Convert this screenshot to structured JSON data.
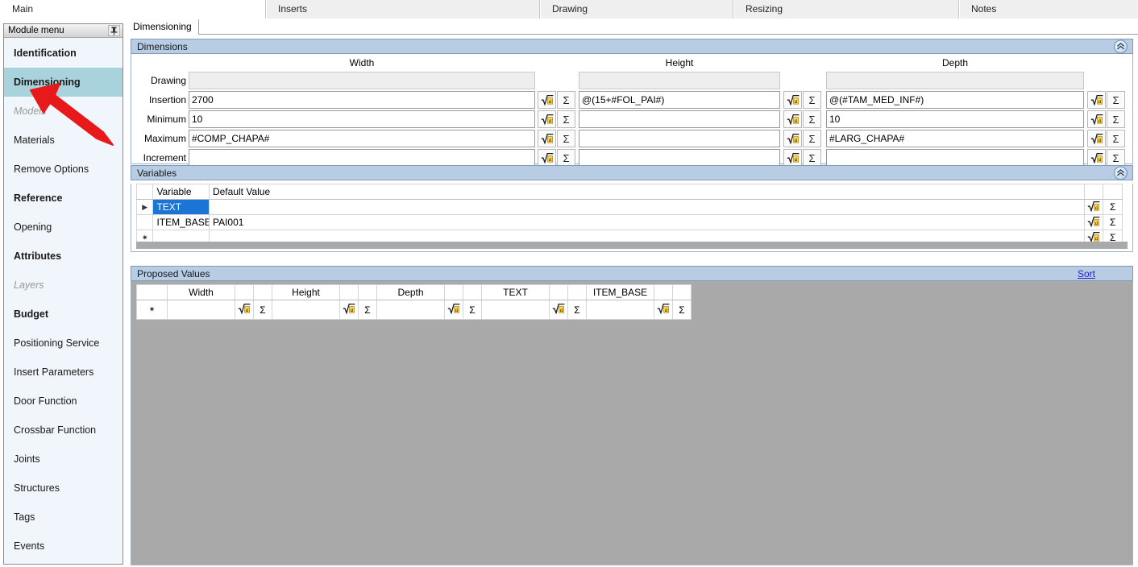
{
  "top_tabs": [
    {
      "label": "Main",
      "active": true
    },
    {
      "label": "Inserts",
      "active": false
    },
    {
      "label": "Drawing",
      "active": false
    },
    {
      "label": "Resizing",
      "active": false
    },
    {
      "label": "Notes",
      "active": false
    }
  ],
  "sub_tabs": [
    {
      "label": "Dimensioning",
      "active": true
    }
  ],
  "sidebar": {
    "title": "Module menu",
    "pin_icon": "pin-icon",
    "items": [
      {
        "label": "Identification",
        "style": "bold",
        "selected": false
      },
      {
        "label": "Dimensioning",
        "style": "bold",
        "selected": true
      },
      {
        "label": "Models",
        "style": "disabled",
        "selected": false
      },
      {
        "label": "Materials",
        "style": "normal",
        "selected": false
      },
      {
        "label": "Remove Options",
        "style": "normal",
        "selected": false
      },
      {
        "label": "Reference",
        "style": "bold",
        "selected": false
      },
      {
        "label": "Opening",
        "style": "normal",
        "selected": false
      },
      {
        "label": "Attributes",
        "style": "bold",
        "selected": false
      },
      {
        "label": "Layers",
        "style": "disabled",
        "selected": false
      },
      {
        "label": "Budget",
        "style": "bold",
        "selected": false
      },
      {
        "label": "Positioning Service",
        "style": "normal",
        "selected": false
      },
      {
        "label": "Insert Parameters",
        "style": "normal",
        "selected": false
      },
      {
        "label": "Door Function",
        "style": "normal",
        "selected": false
      },
      {
        "label": "Crossbar Function",
        "style": "normal",
        "selected": false
      },
      {
        "label": "Joints",
        "style": "normal",
        "selected": false
      },
      {
        "label": "Structures",
        "style": "normal",
        "selected": false
      },
      {
        "label": "Tags",
        "style": "normal",
        "selected": false
      },
      {
        "label": "Events",
        "style": "normal",
        "selected": false
      }
    ]
  },
  "dimensions": {
    "title": "Dimensions",
    "collapse_icon": "chevron-double-up-icon",
    "columns": [
      "Width",
      "Height",
      "Depth"
    ],
    "rows": [
      {
        "label": "Drawing",
        "readonly": true,
        "has_buttons": false,
        "values": [
          "",
          "",
          ""
        ]
      },
      {
        "label": "Insertion",
        "readonly": false,
        "has_buttons": true,
        "values": [
          "2700",
          "@(15+#FOL_PAI#)",
          "@(#TAM_MED_INF#)"
        ]
      },
      {
        "label": "Minimum",
        "readonly": false,
        "has_buttons": true,
        "values": [
          "10",
          "",
          "10"
        ]
      },
      {
        "label": "Maximum",
        "readonly": false,
        "has_buttons": true,
        "values": [
          "#COMP_CHAPA#",
          "",
          "#LARG_CHAPA#"
        ]
      },
      {
        "label": "Increment",
        "readonly": false,
        "has_buttons": true,
        "values": [
          "",
          "",
          ""
        ]
      }
    ],
    "formula_button_icon": "radical-a-icon",
    "sum_button_label": "Σ"
  },
  "variables": {
    "title": "Variables",
    "collapse_icon": "chevron-double-up-icon",
    "columns": [
      "",
      "Variable",
      "Default Value"
    ],
    "rows": [
      {
        "indicator": "▶",
        "variable": "TEXT",
        "default_value": "",
        "selected": true
      },
      {
        "indicator": "",
        "variable": "ITEM_BASE",
        "default_value": "PAI001",
        "selected": false
      },
      {
        "indicator": "✷",
        "variable": "",
        "default_value": "",
        "selected": false
      }
    ],
    "formula_button_icon": "radical-a-icon",
    "sum_button_label": "Σ"
  },
  "proposed_values": {
    "title": "Proposed Values",
    "sort_link": "Sort",
    "columns": [
      "Width",
      "Height",
      "Depth",
      "TEXT",
      "ITEM_BASE"
    ],
    "rows": [
      {
        "indicator": "✷",
        "cells": [
          "",
          "",
          "",
          "",
          ""
        ]
      }
    ],
    "formula_button_icon": "radical-a-icon",
    "sum_button_label": "Σ"
  },
  "colors": {
    "panel_header": "#b8cce4",
    "sidebar_selected": "#a9d3dc",
    "grid_selection": "#1c74d4",
    "link": "#2222cc",
    "filler": "#a9a9a9",
    "annotation_arrow": "#e8191b"
  },
  "annotation": {
    "arrow_icon": "red-arrow-icon",
    "points_to": "Dimensioning"
  }
}
